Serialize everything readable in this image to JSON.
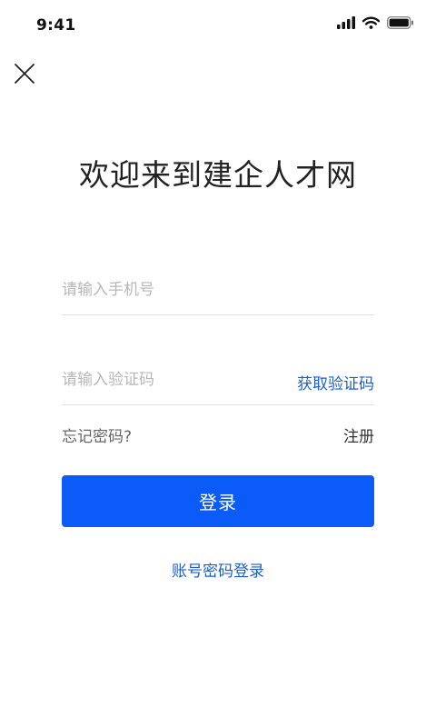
{
  "status_bar": {
    "time": "9:41",
    "icons": [
      "cellular-signal-icon",
      "wifi-icon",
      "battery-icon"
    ]
  },
  "header": {
    "close_icon": "close-icon",
    "title": "欢迎来到建企人才网"
  },
  "form": {
    "phone_placeholder": "请输入手机号",
    "phone_value": "",
    "code_placeholder": "请输入验证码",
    "code_value": "",
    "get_code_label": "获取验证码",
    "forgot_password_label": "忘记密码?",
    "register_label": "注册",
    "login_label": "登录",
    "password_login_label": "账号密码登录"
  },
  "colors": {
    "primary": "#0b5bf8",
    "link": "#1b5fcf",
    "placeholder": "#b7b7b7",
    "divider": "#e3e3e3"
  }
}
